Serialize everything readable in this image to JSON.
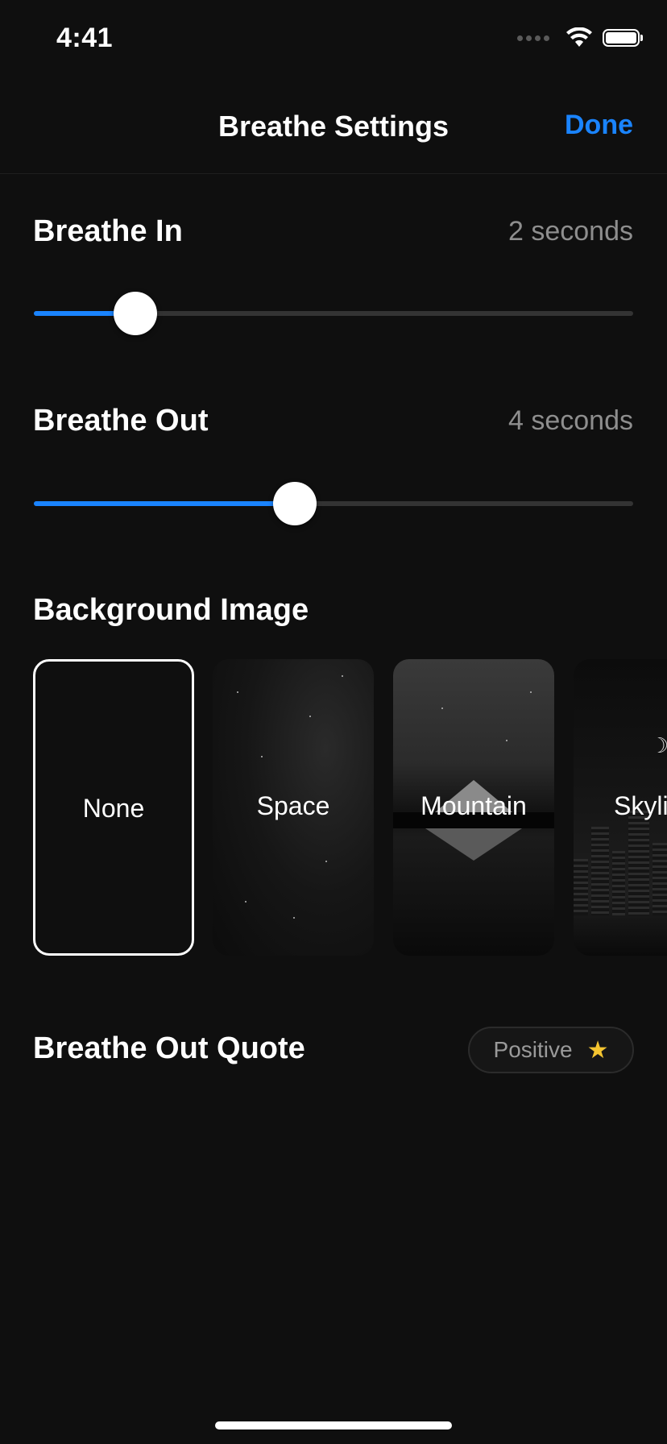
{
  "status_bar": {
    "time": "4:41",
    "icons": [
      "signal-dots-icon",
      "wifi-icon",
      "battery-icon"
    ]
  },
  "nav": {
    "title": "Breathe Settings",
    "done_label": "Done"
  },
  "breathe_in": {
    "label": "Breathe In",
    "value_text": "2 seconds",
    "slider_fraction": 0.169
  },
  "breathe_out": {
    "label": "Breathe Out",
    "value_text": "4 seconds",
    "slider_fraction": 0.435
  },
  "background_image": {
    "label": "Background Image",
    "options": [
      {
        "label": "None",
        "selected": true
      },
      {
        "label": "Space",
        "selected": false
      },
      {
        "label": "Mountain",
        "selected": false
      },
      {
        "label": "Skyli",
        "selected": false
      }
    ]
  },
  "quote": {
    "label": "Breathe Out Quote",
    "pill_text": "Positive",
    "pill_icon": "star-icon"
  },
  "colors": {
    "accent": "#1a84ff",
    "background": "#0f0f0f",
    "secondary_text": "#8e8e8e",
    "track": "#333333"
  }
}
